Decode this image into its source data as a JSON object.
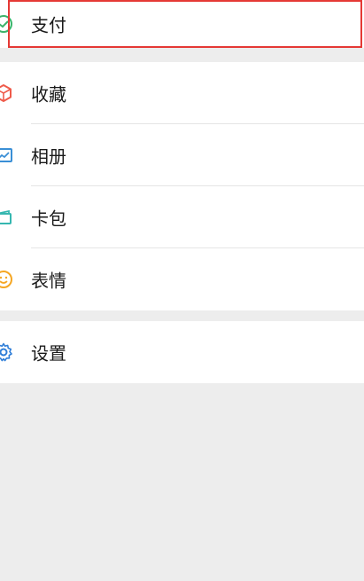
{
  "menu": {
    "pay": {
      "label": "支付",
      "icon": "wallet-icon"
    },
    "favorites": {
      "label": "收藏",
      "icon": "cube-icon"
    },
    "album": {
      "label": "相册",
      "icon": "picture-icon"
    },
    "cards": {
      "label": "卡包",
      "icon": "card-icon"
    },
    "stickers": {
      "label": "表情",
      "icon": "smiley-icon"
    },
    "settings": {
      "label": "设置",
      "icon": "gear-icon"
    }
  },
  "colors": {
    "highlight": "#e53935",
    "pay_icon": "#3bb36a",
    "favorites_icon": "#ef5b4b",
    "album_icon": "#3a8fd6",
    "cards_icon": "#35b7b0",
    "stickers_icon": "#f5a623",
    "settings_icon": "#2f7ed8"
  }
}
